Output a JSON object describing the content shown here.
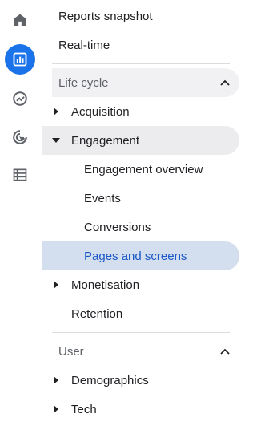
{
  "rail": {
    "items": [
      {
        "name": "home-icon"
      },
      {
        "name": "reports-icon",
        "active": true
      },
      {
        "name": "explore-icon"
      },
      {
        "name": "advertising-icon"
      },
      {
        "name": "configure-icon"
      }
    ]
  },
  "nav": {
    "reports_snapshot": "Reports snapshot",
    "realtime": "Real-time",
    "life_cycle": {
      "title": "Life cycle",
      "acquisition": "Acquisition",
      "engagement": "Engagement",
      "engagement_overview": "Engagement overview",
      "events": "Events",
      "conversions": "Conversions",
      "pages_and_screens": "Pages and screens",
      "monetisation": "Monetisation",
      "retention": "Retention"
    },
    "user": {
      "title": "User",
      "demographics": "Demographics",
      "tech": "Tech"
    }
  },
  "colors": {
    "accent": "#1a73e8",
    "selected_bg": "#d3deee",
    "selected_text": "#1a57c7",
    "hover_bg": "#ececee"
  }
}
